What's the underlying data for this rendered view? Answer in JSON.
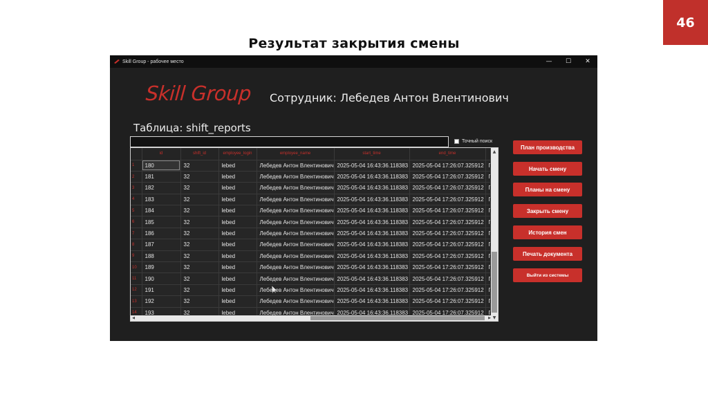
{
  "slide": {
    "number": "46",
    "title": "Результат закрытия смены"
  },
  "window": {
    "title": "Skill Group - рабочее место",
    "controls": {
      "minimize": "—",
      "maximize": "☐",
      "close": "✕"
    }
  },
  "brand": "Skill Group",
  "employee_label": "Сотрудник: Лебедев Антон Влентинович",
  "table_label": "Таблица: shift_reports",
  "search": {
    "value": "",
    "placeholder": ""
  },
  "exact_search_label": "Точный поиск",
  "table": {
    "columns": [
      "id",
      "shift_id",
      "employee_login",
      "employee_name",
      "start_time",
      "end_time",
      ""
    ],
    "rows": [
      {
        "n": "1",
        "id": "180",
        "shift": "32",
        "login": "lebed",
        "name": "Лебедев Антон Влентинович",
        "start": "2025-05-04 16:43:36.118383",
        "end": "2025-05-04 17:26:07.325912",
        "extra": "П"
      },
      {
        "n": "2",
        "id": "181",
        "shift": "32",
        "login": "lebed",
        "name": "Лебедев Антон Влентинович",
        "start": "2025-05-04 16:43:36.118383",
        "end": "2025-05-04 17:26:07.325912",
        "extra": "П"
      },
      {
        "n": "3",
        "id": "182",
        "shift": "32",
        "login": "lebed",
        "name": "Лебедев Антон Влентинович",
        "start": "2025-05-04 16:43:36.118383",
        "end": "2025-05-04 17:26:07.325912",
        "extra": "П"
      },
      {
        "n": "4",
        "id": "183",
        "shift": "32",
        "login": "lebed",
        "name": "Лебедев Антон Влентинович",
        "start": "2025-05-04 16:43:36.118383",
        "end": "2025-05-04 17:26:07.325912",
        "extra": "П"
      },
      {
        "n": "5",
        "id": "184",
        "shift": "32",
        "login": "lebed",
        "name": "Лебедев Антон Влентинович",
        "start": "2025-05-04 16:43:36.118383",
        "end": "2025-05-04 17:26:07.325912",
        "extra": "П"
      },
      {
        "n": "6",
        "id": "185",
        "shift": "32",
        "login": "lebed",
        "name": "Лебедев Антон Влентинович",
        "start": "2025-05-04 16:43:36.118383",
        "end": "2025-05-04 17:26:07.325912",
        "extra": "П"
      },
      {
        "n": "7",
        "id": "186",
        "shift": "32",
        "login": "lebed",
        "name": "Лебедев Антон Влентинович",
        "start": "2025-05-04 16:43:36.118383",
        "end": "2025-05-04 17:26:07.325912",
        "extra": "П"
      },
      {
        "n": "8",
        "id": "187",
        "shift": "32",
        "login": "lebed",
        "name": "Лебедев Антон Влентинович",
        "start": "2025-05-04 16:43:36.118383",
        "end": "2025-05-04 17:26:07.325912",
        "extra": "П"
      },
      {
        "n": "9",
        "id": "188",
        "shift": "32",
        "login": "lebed",
        "name": "Лебедев Антон Влентинович",
        "start": "2025-05-04 16:43:36.118383",
        "end": "2025-05-04 17:26:07.325912",
        "extra": "П"
      },
      {
        "n": "10",
        "id": "189",
        "shift": "32",
        "login": "lebed",
        "name": "Лебедев Антон Влентинович",
        "start": "2025-05-04 16:43:36.118383",
        "end": "2025-05-04 17:26:07.325912",
        "extra": "П"
      },
      {
        "n": "11",
        "id": "190",
        "shift": "32",
        "login": "lebed",
        "name": "Лебедев Антон Влентинович",
        "start": "2025-05-04 16:43:36.118383",
        "end": "2025-05-04 17:26:07.325912",
        "extra": "П"
      },
      {
        "n": "12",
        "id": "191",
        "shift": "32",
        "login": "lebed",
        "name": "Лебедев Антон Влентинович",
        "start": "2025-05-04 16:43:36.118383",
        "end": "2025-05-04 17:26:07.325912",
        "extra": "П"
      },
      {
        "n": "13",
        "id": "192",
        "shift": "32",
        "login": "lebed",
        "name": "Лебедев Антон Влентинович",
        "start": "2025-05-04 16:43:36.118383",
        "end": "2025-05-04 17:26:07.325912",
        "extra": "П"
      },
      {
        "n": "14",
        "id": "193",
        "shift": "32",
        "login": "lebed",
        "name": "Лебедев Антон Влентинович",
        "start": "2025-05-04 16:43:36.118383",
        "end": "2025-05-04 17:26:07.325912",
        "extra": "П"
      }
    ]
  },
  "buttons": [
    "План производства",
    "Начать смену",
    "Планы на смену",
    "Закрыть смену",
    "История смен",
    "Печать документа",
    "Выйти из системы"
  ],
  "colors": {
    "accent": "#c8302b",
    "window_bg": "#1f1f1f",
    "grid_bg": "#262626"
  }
}
